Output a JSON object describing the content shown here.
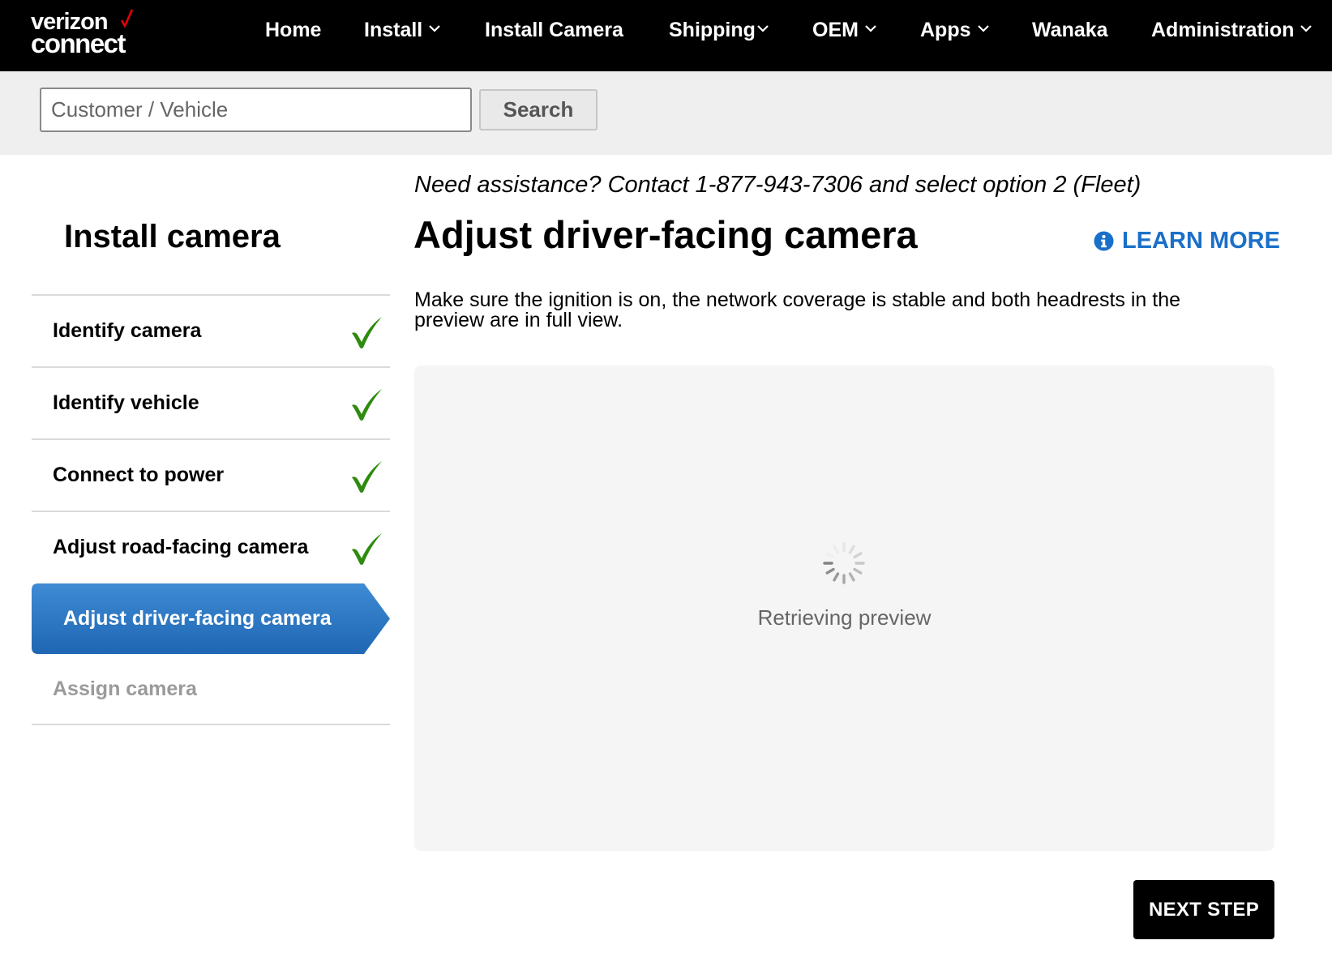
{
  "brand": {
    "line1": "verizon",
    "line2": "connect",
    "accent_color": "#ee0000"
  },
  "nav": {
    "items": [
      {
        "label": "Home",
        "dropdown": false
      },
      {
        "label": "Install",
        "dropdown": true
      },
      {
        "label": "Install Camera",
        "dropdown": false
      },
      {
        "label": "Shipping",
        "dropdown": true
      },
      {
        "label": "OEM",
        "dropdown": true
      },
      {
        "label": "Apps",
        "dropdown": true
      },
      {
        "label": "Wanaka",
        "dropdown": false
      },
      {
        "label": "Administration",
        "dropdown": true
      }
    ]
  },
  "search": {
    "placeholder": "Customer / Vehicle",
    "value": "",
    "button_label": "Search"
  },
  "sidebar": {
    "title": "Install camera",
    "steps": [
      {
        "label": "Identify camera",
        "status": "complete"
      },
      {
        "label": "Identify vehicle",
        "status": "complete"
      },
      {
        "label": "Connect to power",
        "status": "complete"
      },
      {
        "label": "Adjust road-facing camera",
        "status": "complete"
      },
      {
        "label": "Adjust driver-facing camera",
        "status": "active"
      },
      {
        "label": "Assign camera",
        "status": "pending"
      }
    ]
  },
  "main": {
    "assist_text": "Need assistance? Contact 1-877-943-7306 and select option 2 (Fleet)",
    "title": "Adjust driver-facing camera",
    "learn_more_label": "LEARN MORE",
    "instruction_line1": "Make sure the ignition is on, the network coverage is stable and both headrests in the",
    "instruction_line2": "preview are in full view.",
    "preview_status": "Retrieving preview",
    "next_button_label": "NEXT STEP"
  },
  "colors": {
    "nav_bg": "#000000",
    "active_step": "#2a74c0",
    "check_green": "#2e8b0e",
    "link_blue": "#1a6fc9"
  },
  "icons": {
    "check": "checkmark-icon",
    "info": "info-circle-icon",
    "chevron": "chevron-down-icon",
    "spinner": "loading-spinner-icon"
  }
}
